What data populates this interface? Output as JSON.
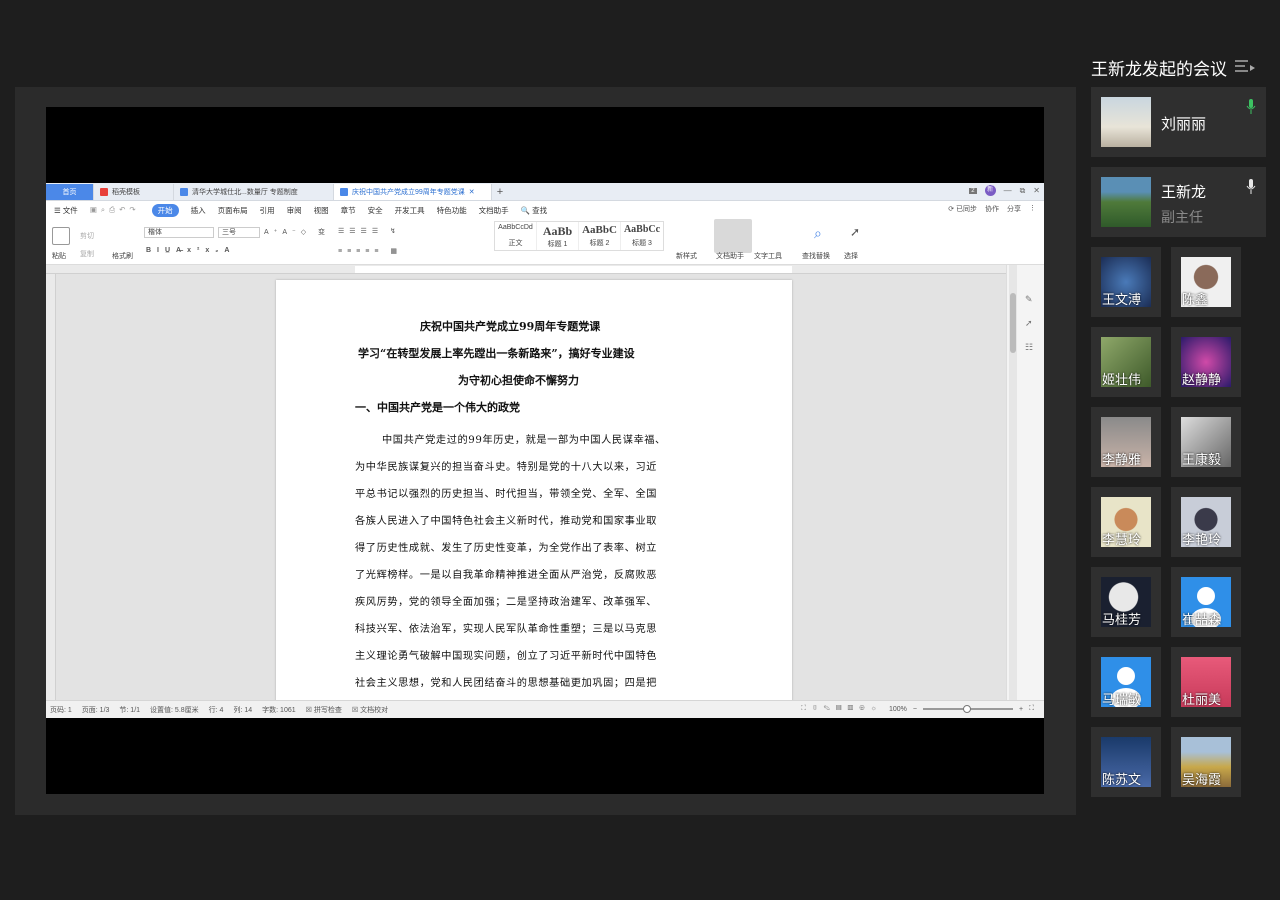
{
  "sidebar": {
    "title": "王新龙发起的会议",
    "featured": [
      {
        "name": "刘丽丽",
        "subtitle": "",
        "mic_color": "#3cc262"
      },
      {
        "name": "王新龙",
        "subtitle": "副主任",
        "mic_color": "#e8e8e8"
      }
    ],
    "participants": [
      "王文溥",
      "陈鑫",
      "姬壮伟",
      "赵静静",
      "李静雅",
      "王康毅",
      "李慧玲",
      "李艳玲",
      "马桂芳",
      "崔喆森",
      "马瑞敏",
      "杜丽美",
      "陈苏文",
      "吴海霞"
    ]
  },
  "wps": {
    "tabs": [
      {
        "label": "首页",
        "icon_color": ""
      },
      {
        "label": "稻壳模板",
        "icon_color": "#e8403a"
      },
      {
        "label": "清华大学城仕北...数量厅 专题制度",
        "icon_color": "#4b88e8"
      },
      {
        "label": "庆祝中国共产党成立99周年专题党课",
        "icon_color": "#4b88e8"
      }
    ],
    "add_tab": "+",
    "window": {
      "badge": "2",
      "user": "新",
      "min": "—",
      "max": "⧉",
      "close": "✕"
    },
    "menu": {
      "file": "☰ 文件",
      "items": [
        "开始",
        "插入",
        "页面布局",
        "引用",
        "审阅",
        "视图",
        "章节",
        "安全",
        "开发工具",
        "特色功能",
        "文档助手",
        "🔍 查找"
      ],
      "active": "开始",
      "right": [
        "⟳ 已同步",
        "协作",
        "分享",
        "⋮"
      ]
    },
    "ribbon": {
      "paste": "粘贴",
      "cut": "剪切",
      "copy": "复制",
      "format_painter": "格式刷",
      "font_name": "楷体",
      "font_size": "三号",
      "styles": [
        {
          "preview": "AaBbCcDd",
          "label": "正文"
        },
        {
          "preview": "AaBb",
          "label": "标题 1"
        },
        {
          "preview": "AaBbC",
          "label": "标题 2"
        },
        {
          "preview": "AaBbCc",
          "label": "标题 3"
        }
      ],
      "new_style": "新样式",
      "doc_assistant": "文档助手",
      "text_tools": "文字工具",
      "find_replace": "查找替换",
      "select": "选择"
    },
    "document": {
      "title": "庆祝中国共产党成立99周年专题党课",
      "subtitle1": "学习“在转型发展上率先蹚出一条新路来”，搞好专业建设",
      "subtitle2": "为守初心担使命不懈努力",
      "heading": "一、中国共产党是一个伟大的政党",
      "body": [
        "中国共产党走过的99年历史，就是一部为中国人民谋幸福、",
        "为中华民族谋复兴的担当奋斗史。特别是党的十八大以来，习近",
        "平总书记以强烈的历史担当、时代担当，带领全党、全军、全国",
        "各族人民进入了中国特色社会主义新时代，推动党和国家事业取",
        "得了历史性成就、发生了历史性变革，为全党作出了表率、树立",
        "了光辉榜样。一是以自我革命精神推进全面从严治党，反腐败恶",
        "疾风厉势，党的领导全面加强；二是坚持政治建军、改革强军、",
        "科技兴军、依法治军，实现人民军队革命性重塑；三是以马克思",
        "主义理论勇气破解中国现实问题，创立了习近平新时代中国特色",
        "社会主义思想，党和人民团结奋斗的思想基础更加巩固；四是把"
      ]
    },
    "status": {
      "items": [
        "页码: 1",
        "页面: 1/3",
        "节: 1/1",
        "设置值: 5.8厘米",
        "行: 4",
        "列: 14",
        "字数: 1061",
        "☒ 拼写检查",
        "☒ 文档校对"
      ],
      "zoom": "100%",
      "minus": "−",
      "plus": "+"
    }
  }
}
